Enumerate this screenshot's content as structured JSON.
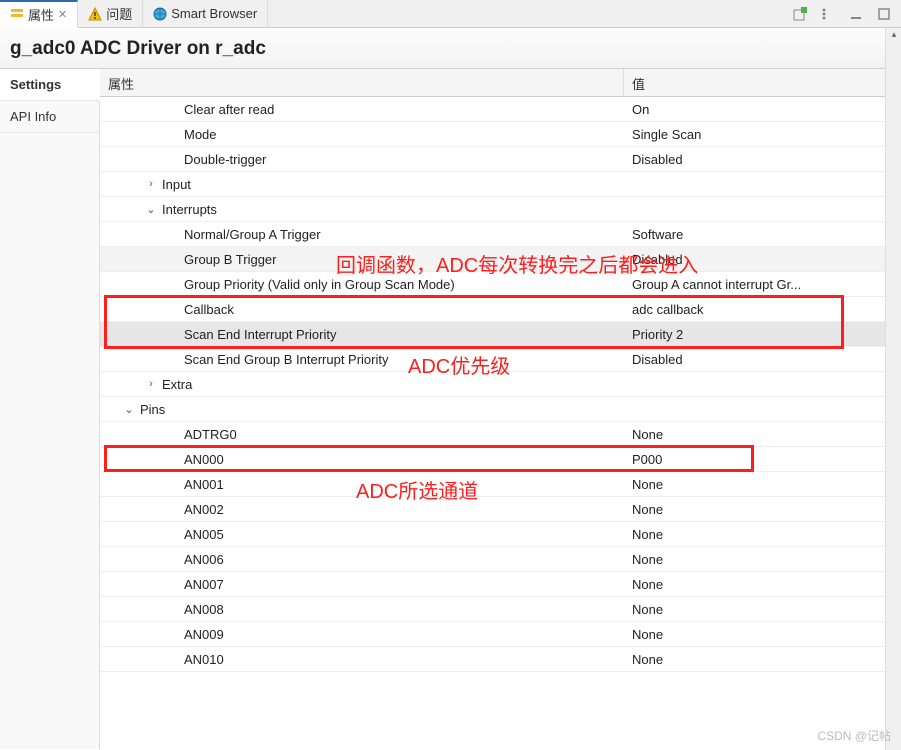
{
  "tabs": {
    "props": "属性",
    "problems": "问题",
    "browser": "Smart Browser"
  },
  "title": "g_adc0 ADC Driver on r_adc",
  "sidebar": {
    "settings": "Settings",
    "api": "API Info"
  },
  "headers": {
    "prop": "属性",
    "val": "值"
  },
  "rows": [
    {
      "indent": 3,
      "exp": "",
      "prop": "Clear after read",
      "val": "On"
    },
    {
      "indent": 3,
      "exp": "",
      "prop": "Mode",
      "val": "Single Scan"
    },
    {
      "indent": 3,
      "exp": "",
      "prop": "Double-trigger",
      "val": "Disabled"
    },
    {
      "indent": 2,
      "exp": "closed",
      "prop": "Input",
      "val": ""
    },
    {
      "indent": 2,
      "exp": "open",
      "prop": "Interrupts",
      "val": ""
    },
    {
      "indent": 3,
      "exp": "",
      "prop": "Normal/Group A Trigger",
      "val": "Software"
    },
    {
      "indent": 3,
      "exp": "",
      "prop": "Group B Trigger",
      "val": "Disabled",
      "lite": true
    },
    {
      "indent": 3,
      "exp": "",
      "prop": "Group Priority (Valid only in Group Scan Mode)",
      "val": "Group A cannot interrupt Gr..."
    },
    {
      "indent": 3,
      "exp": "",
      "prop": "Callback",
      "val": "adc callback"
    },
    {
      "indent": 3,
      "exp": "",
      "prop": "Scan End Interrupt Priority",
      "val": "Priority 2",
      "sel": true
    },
    {
      "indent": 3,
      "exp": "",
      "prop": "Scan End Group B Interrupt Priority",
      "val": "Disabled"
    },
    {
      "indent": 2,
      "exp": "closed",
      "prop": "Extra",
      "val": ""
    },
    {
      "indent": 1,
      "exp": "open",
      "prop": "Pins",
      "val": ""
    },
    {
      "indent": 3,
      "exp": "",
      "prop": "ADTRG0",
      "val": "None"
    },
    {
      "indent": 3,
      "exp": "",
      "prop": "AN000",
      "val": "P000"
    },
    {
      "indent": 3,
      "exp": "",
      "prop": "AN001",
      "val": "None"
    },
    {
      "indent": 3,
      "exp": "",
      "prop": "AN002",
      "val": "None"
    },
    {
      "indent": 3,
      "exp": "",
      "prop": "AN005",
      "val": "None"
    },
    {
      "indent": 3,
      "exp": "",
      "prop": "AN006",
      "val": "None"
    },
    {
      "indent": 3,
      "exp": "",
      "prop": "AN007",
      "val": "None"
    },
    {
      "indent": 3,
      "exp": "",
      "prop": "AN008",
      "val": "None"
    },
    {
      "indent": 3,
      "exp": "",
      "prop": "AN009",
      "val": "None"
    },
    {
      "indent": 3,
      "exp": "",
      "prop": "AN010",
      "val": "None"
    }
  ],
  "annotations": {
    "callback_label": "回调函数，ADC每次转换完之后都会进入",
    "priority_label": "ADC优先级",
    "channel_label": "ADC所选通道"
  },
  "watermark": "CSDN @记帖"
}
